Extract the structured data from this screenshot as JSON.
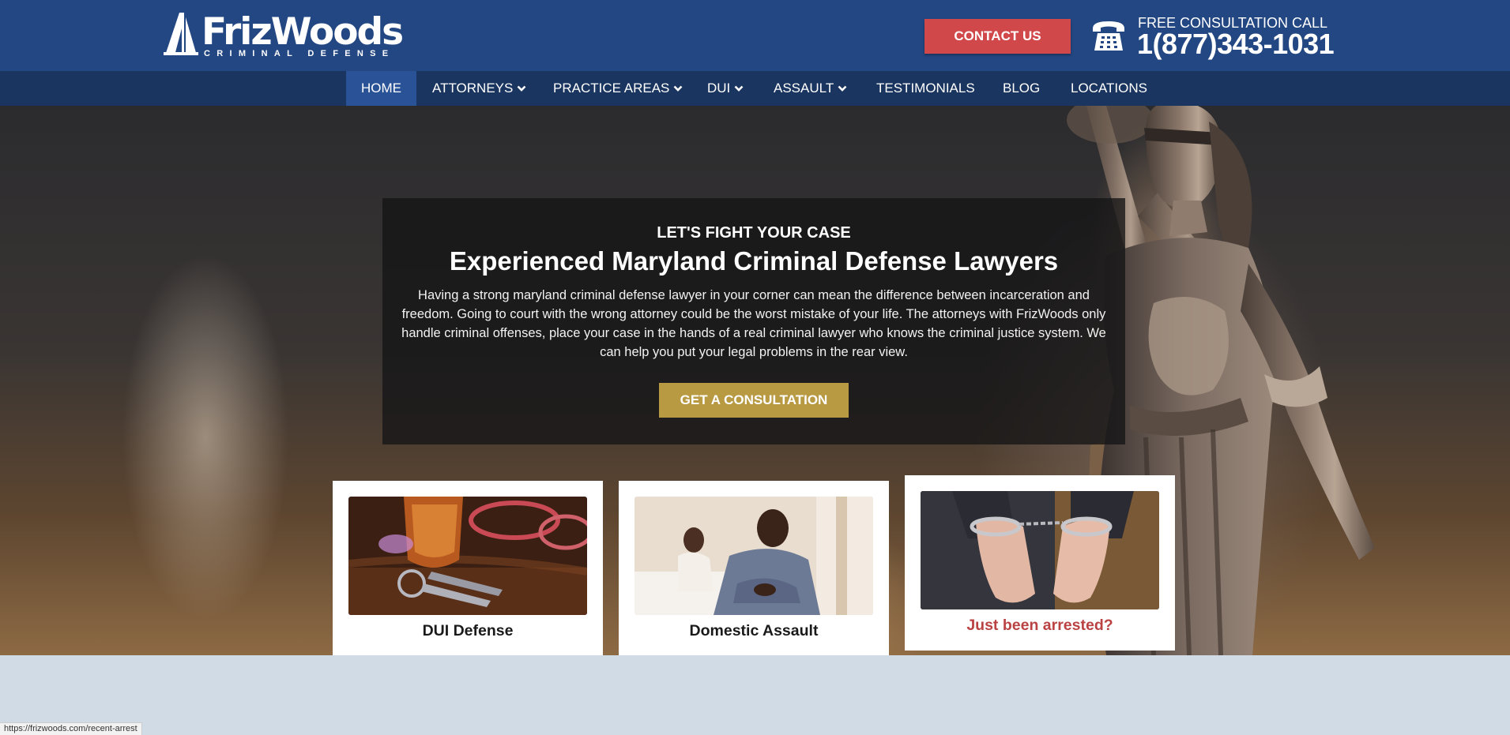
{
  "header": {
    "logo_name": "FrizWoods",
    "logo_sub": "CRIMINAL DEFENSE",
    "contact_label": "CONTACT US",
    "call_label": "FREE CONSULTATION CALL",
    "phone": "1(877)343-1031"
  },
  "nav": {
    "items": [
      {
        "label": "HOME",
        "active": true
      },
      {
        "label": "ATTORNEYS",
        "dropdown": true
      },
      {
        "label": "PRACTICE AREAS",
        "dropdown": true
      },
      {
        "label": "DUI",
        "dropdown": true
      },
      {
        "label": "ASSAULT",
        "dropdown": true
      },
      {
        "label": "TESTIMONIALS"
      },
      {
        "label": "BLOG"
      },
      {
        "label": "LOCATIONS"
      }
    ]
  },
  "hero": {
    "eyebrow": "LET'S FIGHT YOUR CASE",
    "headline": "Experienced Maryland Criminal Defense Lawyers",
    "description": "Having a strong maryland criminal defense lawyer in your corner can mean the difference between incarceration and freedom. Going to court with the wrong attorney could be the worst mistake of your life. The attorneys with FrizWoods only handle criminal offenses, place your case in the hands of a real criminal lawyer who knows the criminal justice system. We can help you put your legal problems in the rear view.",
    "cta_label": "GET A CONSULTATION"
  },
  "cards": [
    {
      "label": "DUI Defense",
      "image": "car-keys-and-drink-image"
    },
    {
      "label": "Domestic Assault",
      "image": "upset-couple-image"
    },
    {
      "label": "Just been arrested?",
      "image": "handcuffed-hands-image",
      "hovered": true
    }
  ],
  "status_bar": {
    "url": "https://frizwoods.com/recent-arrest"
  },
  "colors": {
    "header_bg": "#234782",
    "nav_bg": "#1a355f",
    "nav_active": "#2a5296",
    "contact_button": "#d0484a",
    "cta_button": "#b89a43",
    "card_highlight_text": "#bb4243"
  }
}
